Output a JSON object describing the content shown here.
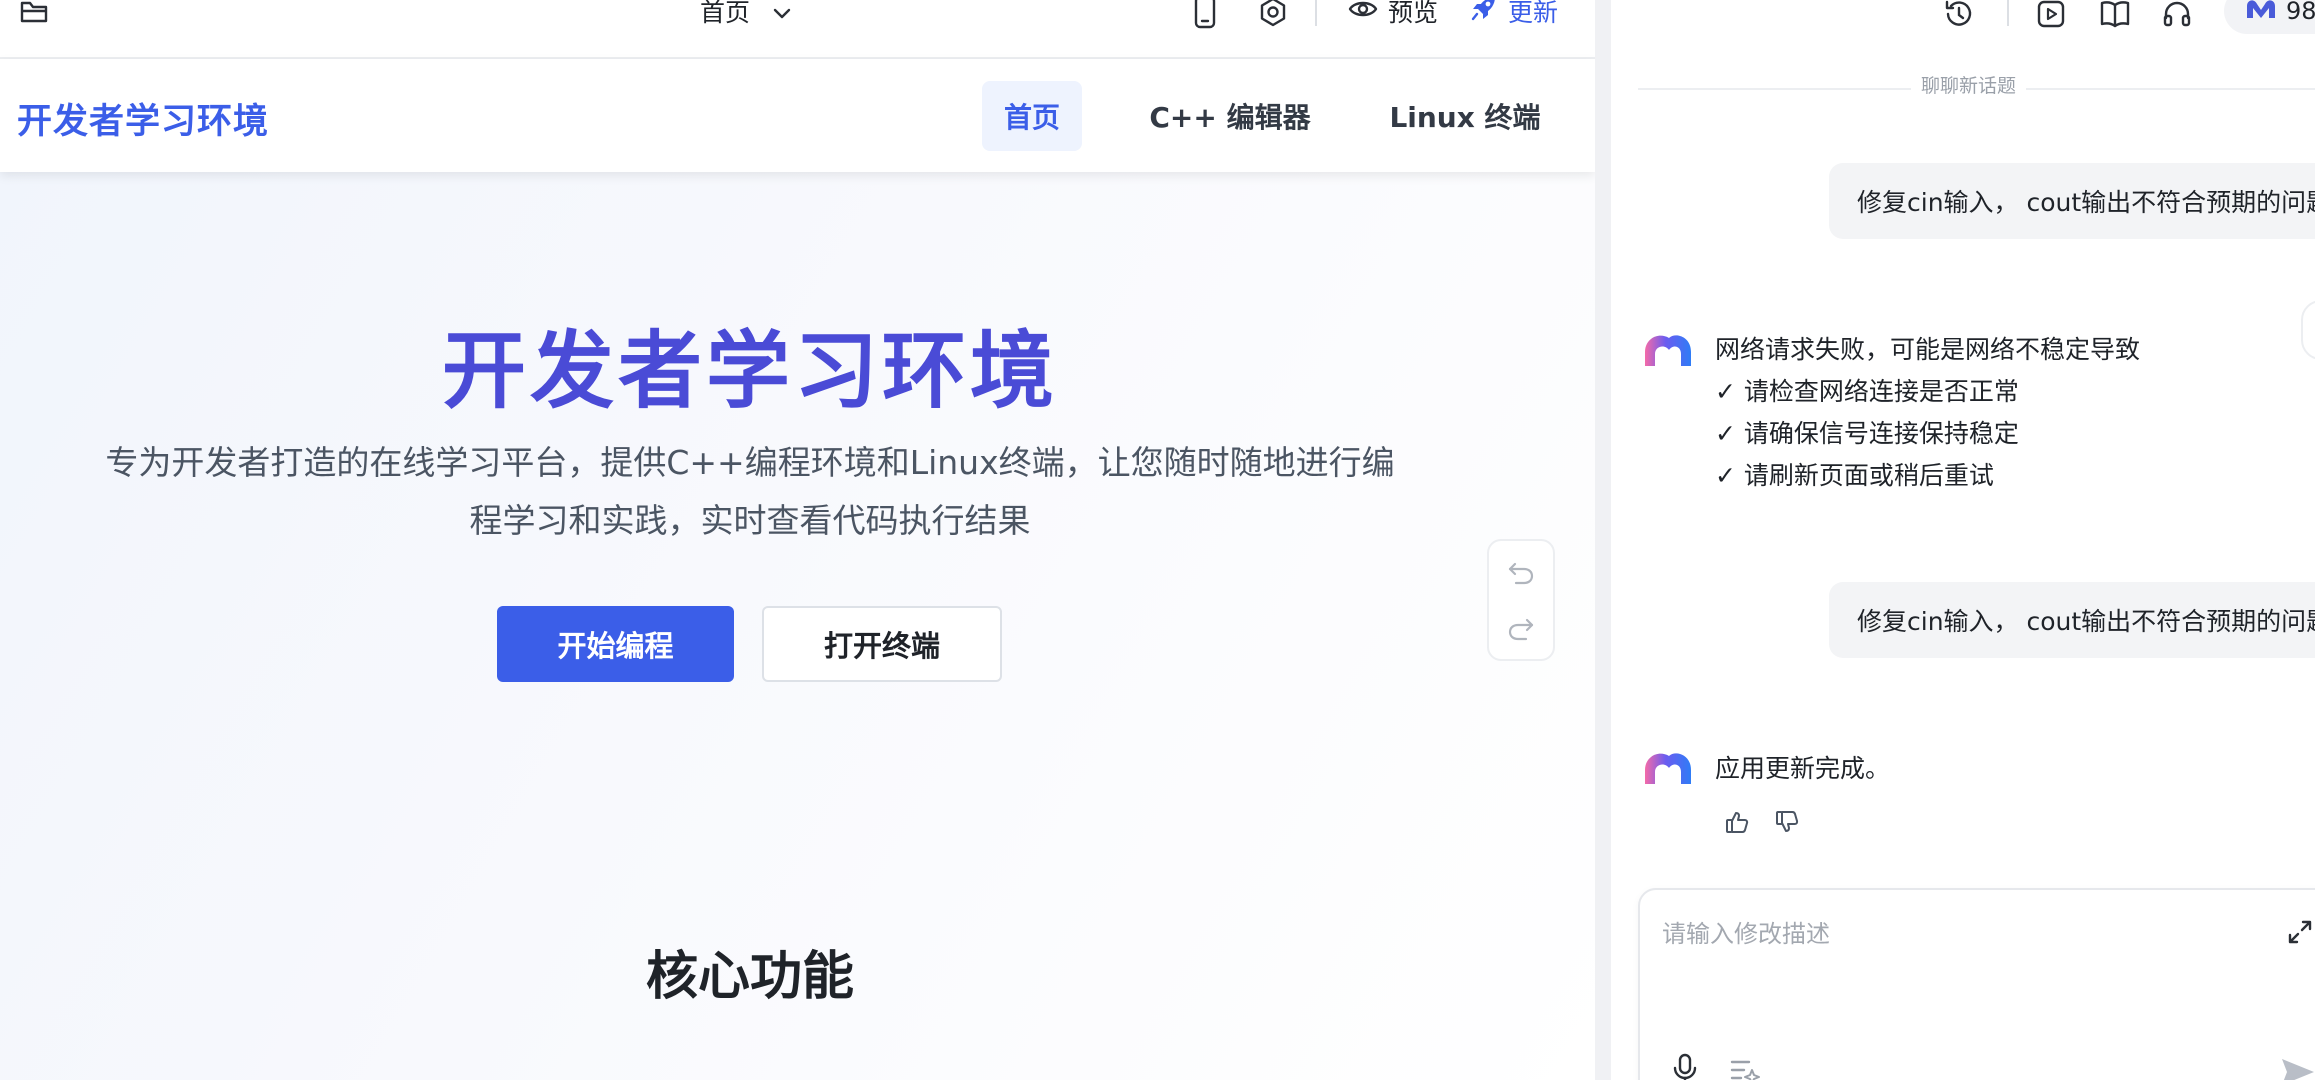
{
  "toolbar": {
    "page_select_label": "首页",
    "preview_label": "预览",
    "update_label": "更新",
    "accent_color": "#3b5ee8"
  },
  "site": {
    "logo": "开发者学习环境",
    "nav": [
      {
        "label": "首页",
        "active": true
      },
      {
        "label": "C++ 编辑器",
        "active": false
      },
      {
        "label": "Linux 终端",
        "active": false
      }
    ],
    "hero": {
      "title": "开发者学习环境",
      "description_line1": "专为开发者打造的在线学习平台，提供C++编程环境和Linux终端，让您随时随地进行编",
      "description_line2": "程学习和实践，实时查看代码执行结果",
      "primary_button": "开始编程",
      "secondary_button": "打开终端"
    },
    "section_title": "核心功能"
  },
  "chat": {
    "credit_partial": "98",
    "history_label": "聊聊新话题",
    "messages": [
      {
        "role": "user",
        "text": "修复cin输入， cout输出不符合预期的问题"
      },
      {
        "role": "assistant",
        "lines": [
          "网络请求失败，可能是网络不稳定导致",
          "✓ 请检查网络连接是否正常",
          "✓ 请确保信号连接保持稳定",
          "✓ 请刷新页面或稍后重试"
        ]
      },
      {
        "role": "user",
        "text": "修复cin输入， cout输出不符合预期的问题"
      },
      {
        "role": "assistant",
        "lines": [
          "应用更新完成。"
        ]
      }
    ],
    "composer": {
      "placeholder": "请输入修改描述",
      "value": ""
    }
  },
  "icons": {
    "toolbar_left": "folder-icon",
    "device": "mobile-icon",
    "settings": "gear-icon",
    "preview": "eye-icon",
    "update": "rocket-icon",
    "undo": "undo-icon",
    "redo": "redo-icon",
    "history": "history-icon",
    "video": "play-icon",
    "docs": "book-icon",
    "support": "headset-icon",
    "like": "thumbs-up-icon",
    "dislike": "thumbs-down-icon",
    "expand": "expand-icon",
    "mic": "mic-icon",
    "prompt": "prompt-list-icon",
    "send": "send-icon"
  }
}
